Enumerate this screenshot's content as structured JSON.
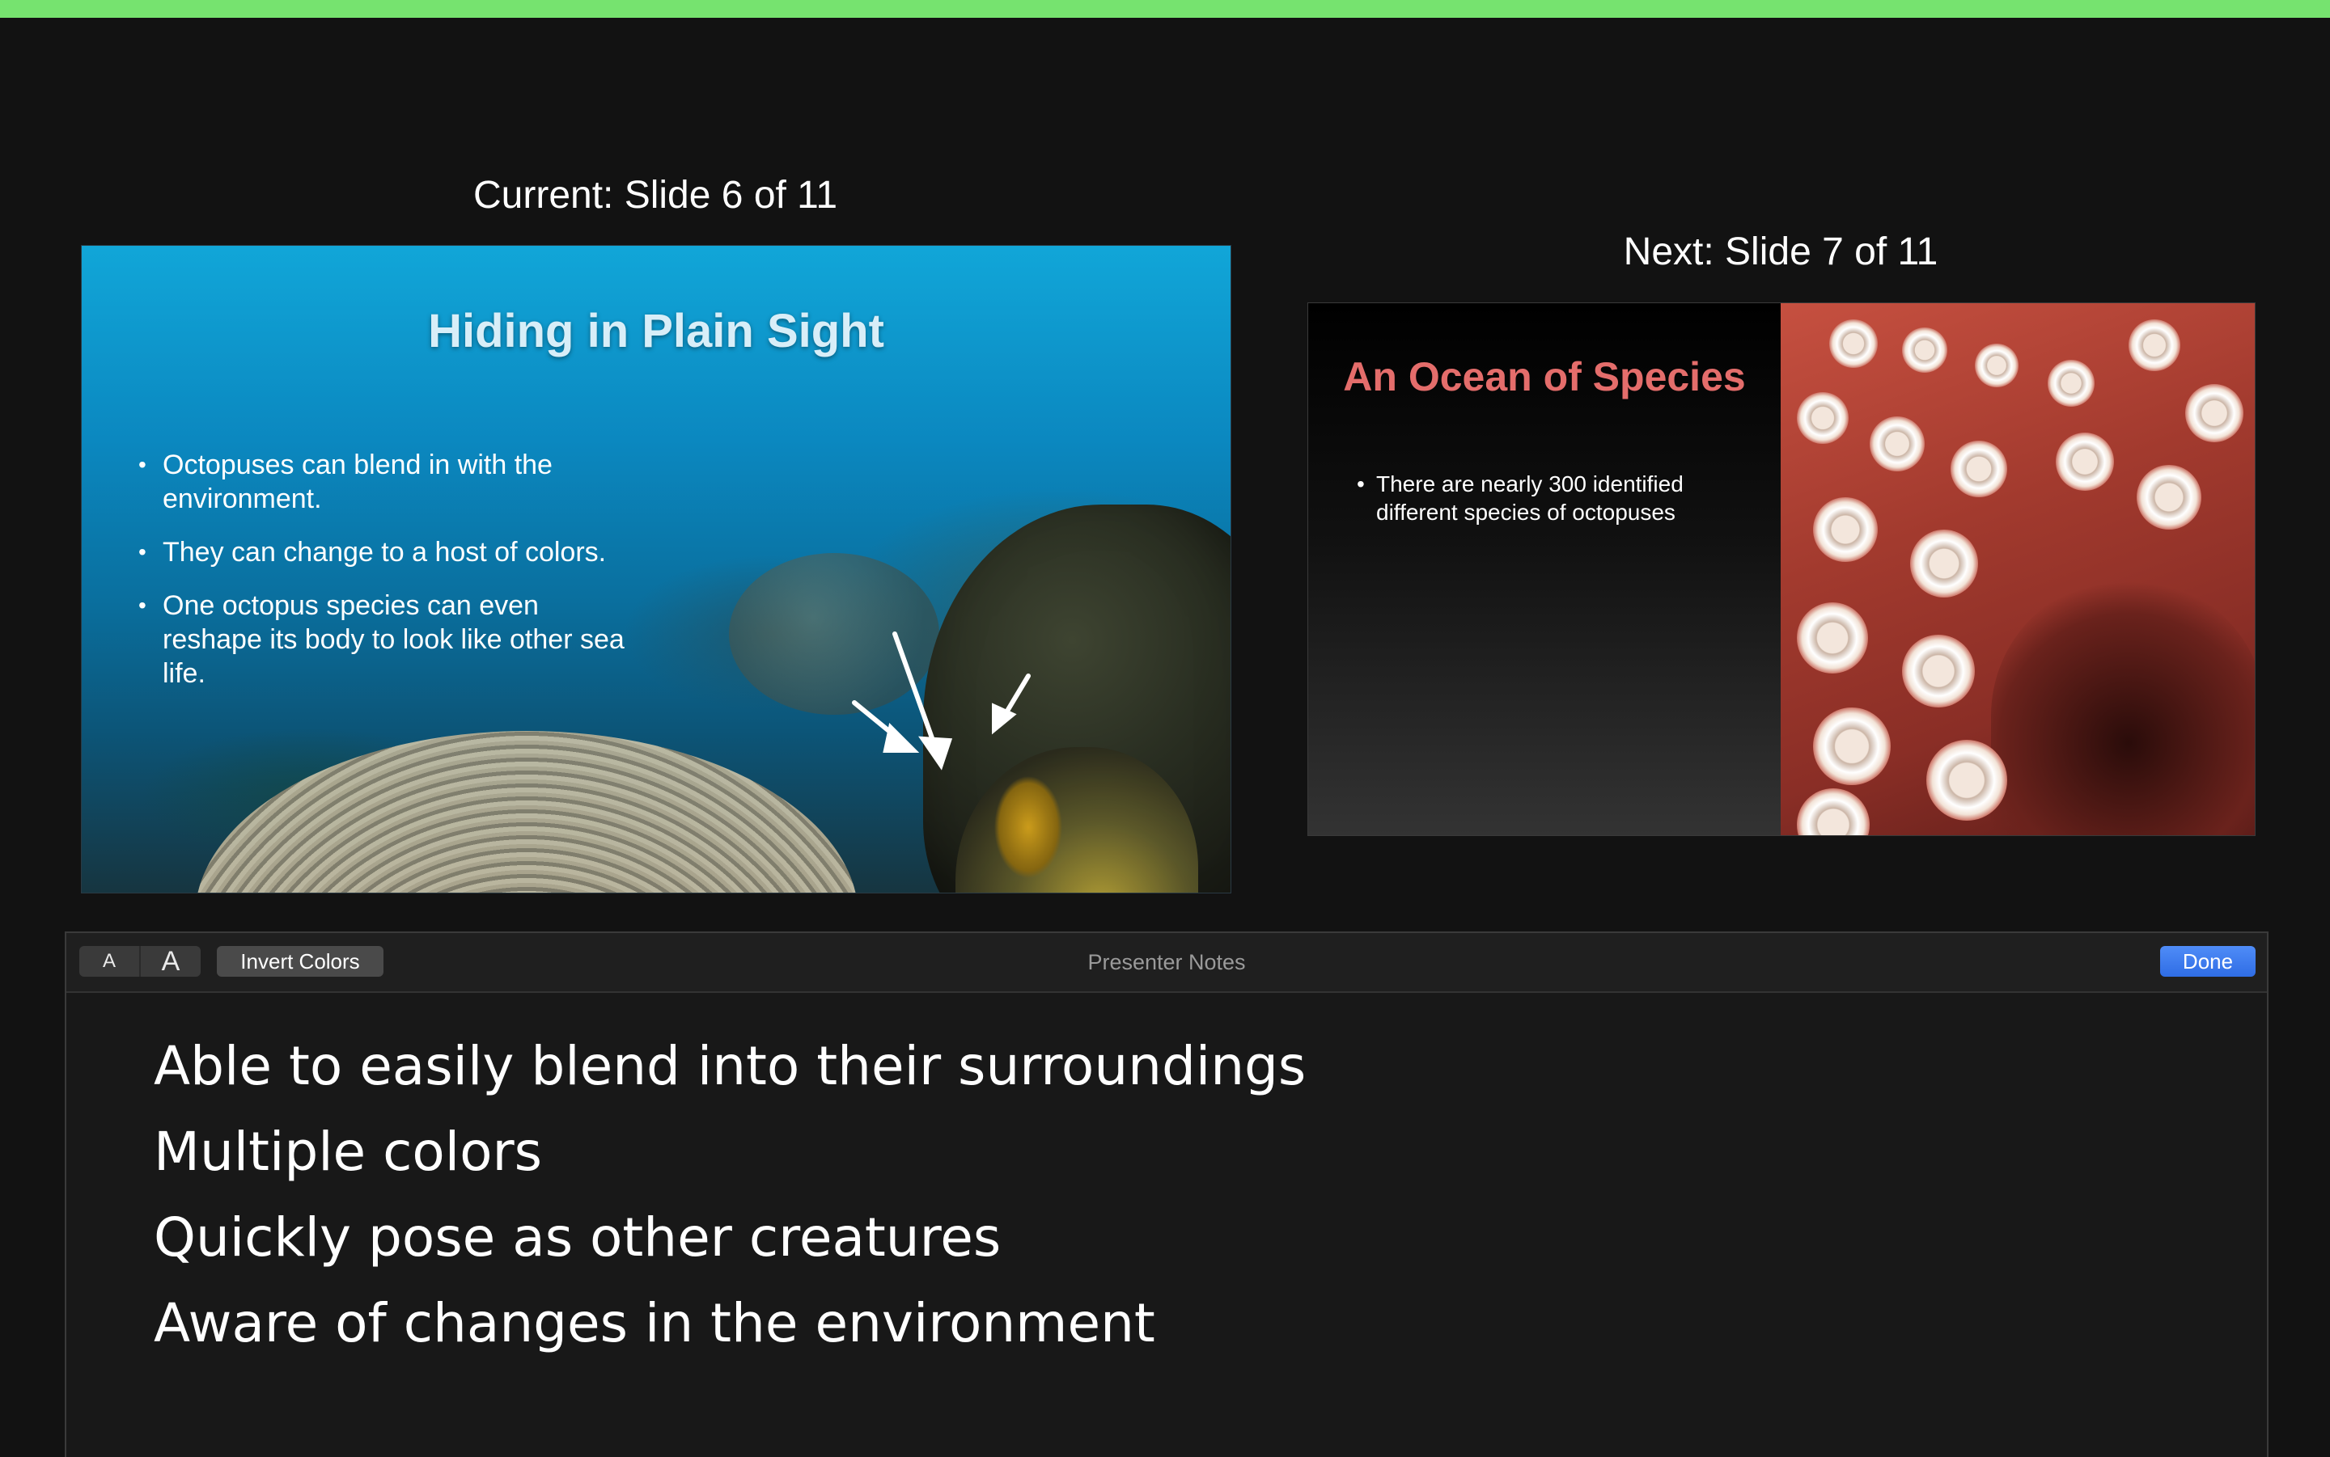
{
  "colors": {
    "top_bar": "#76e36f",
    "background": "#121212",
    "done_button": "#3a78ee",
    "next_title": "#e46d6b"
  },
  "current": {
    "label": "Current: Slide 6 of 11",
    "slide_title": "Hiding in Plain Sight",
    "bullets": [
      "Octopuses can blend in with the environment.",
      "They can change to a host of colors.",
      "One octopus species can even reshape its body to look like other sea life."
    ]
  },
  "next": {
    "label": "Next: Slide 7 of 11",
    "slide_title": "An Ocean of Species",
    "bullets": [
      "There are nearly 300 identified different species of octopuses"
    ]
  },
  "notes": {
    "toolbar": {
      "font_smaller": "A",
      "font_larger": "A",
      "invert_colors": "Invert Colors",
      "title": "Presenter Notes",
      "done": "Done"
    },
    "lines": [
      "Able to easily blend into their surroundings",
      "Multiple colors",
      "Quickly pose as other creatures",
      "Aware of changes in the environment"
    ]
  }
}
